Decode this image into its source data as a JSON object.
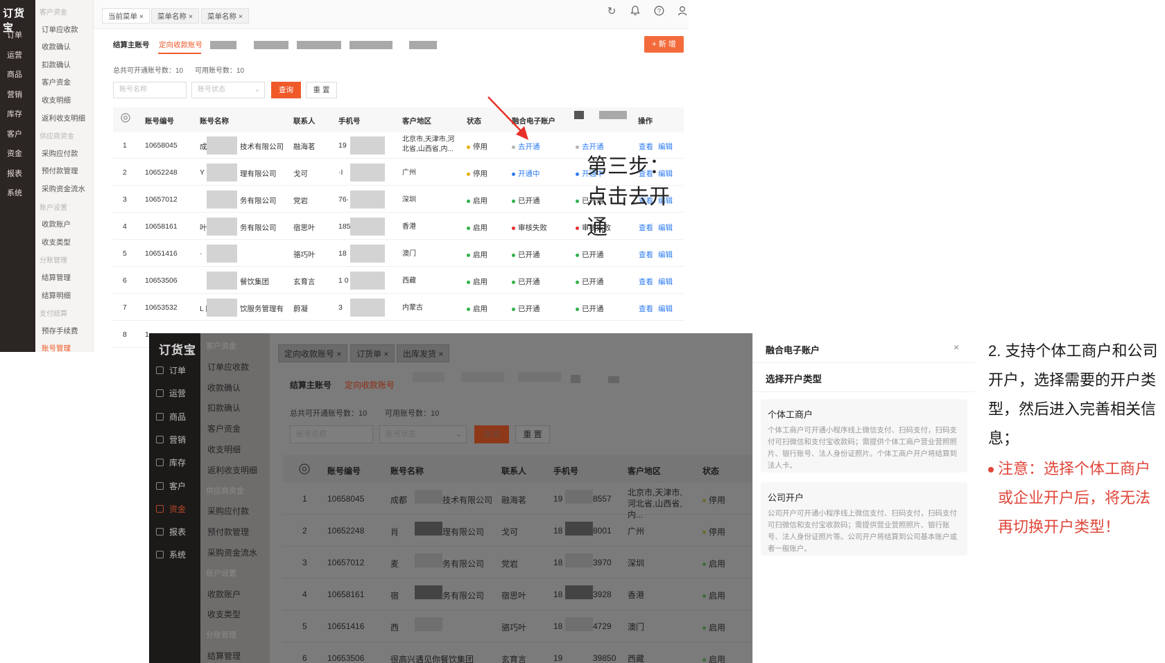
{
  "colors": {
    "accent": "#f05a28",
    "link": "#2d7cf0",
    "warn": "#e0463a",
    "ok": "#30b14a",
    "pause": "#e5b000",
    "fail": "#e03030"
  },
  "top": {
    "logo": "订货宝",
    "nav": [
      "订单",
      "运营",
      "商品",
      "营销",
      "库存",
      "客户",
      "资金",
      "报表",
      "系统"
    ],
    "sub_nav": [
      {
        "type": "group",
        "label": "客户资金"
      },
      {
        "type": "item",
        "label": "订单应收款"
      },
      {
        "type": "item",
        "label": "收款确认"
      },
      {
        "type": "item",
        "label": "扣款确认"
      },
      {
        "type": "item",
        "label": "客户资金"
      },
      {
        "type": "item",
        "label": "收支明细"
      },
      {
        "type": "item",
        "label": "返利收支明细"
      },
      {
        "type": "group",
        "label": "供应商资金"
      },
      {
        "type": "item",
        "label": "采购应付款"
      },
      {
        "type": "item",
        "label": "预付款管理"
      },
      {
        "type": "item",
        "label": "采购资金流水"
      },
      {
        "type": "group",
        "label": "账户设置"
      },
      {
        "type": "item",
        "label": "收款账户"
      },
      {
        "type": "item",
        "label": "收支类型"
      },
      {
        "type": "group",
        "label": "分账管理"
      },
      {
        "type": "item",
        "label": "结算管理"
      },
      {
        "type": "item",
        "label": "结算明细"
      },
      {
        "type": "group",
        "label": "支付结算"
      },
      {
        "type": "item",
        "label": "预存手续费"
      },
      {
        "type": "item",
        "label": "账号管理"
      }
    ],
    "tabs": [
      "当前菜单 ×",
      "菜单名称 ×",
      "菜单名称 ×"
    ],
    "subtabs": [
      "结算主账号",
      "定向收款账号"
    ],
    "add_button": "+ 新 增",
    "count_total": "总共可开通账号数：10",
    "count_avail": "可用账号数：10",
    "search_name_placeholder": "账号名称",
    "search_status_placeholder": "账号状态",
    "query_button": "查询",
    "reset_button": "重 置",
    "columns": [
      "账号编号",
      "账号名称",
      "联系人",
      "手机号",
      "客户地区",
      "状态",
      "融合电子账户",
      "操作"
    ],
    "rows": [
      {
        "idx": "1",
        "id": "10658045",
        "name_a": "成",
        "name_b": "技术有限公司",
        "contact": "融海茗",
        "phone": "19",
        "region": "北京市,天津市,河北省,山西省,内...",
        "status": "停用",
        "status_kind": "pause",
        "fusion": "去开通",
        "fusion_kind": "link",
        "extra": "去开通",
        "extra_kind": "link"
      },
      {
        "idx": "2",
        "id": "10652248",
        "name_a": "Y",
        "name_b": "理有限公司",
        "contact": "戈可",
        "phone": "·I",
        "region": "广州",
        "status": "停用",
        "status_kind": "pause",
        "fusion": "开通中",
        "fusion_kind": "blue",
        "extra": "开通中",
        "extra_kind": "blue"
      },
      {
        "idx": "3",
        "id": "10657012",
        "name_a": "",
        "name_b": "务有限公司",
        "contact": "党岩",
        "phone": "76·",
        "region": "深圳",
        "status": "启用",
        "status_kind": "ok",
        "fusion": "已开通",
        "fusion_kind": "ok",
        "extra": "已开通",
        "extra_kind": "ok"
      },
      {
        "idx": "4",
        "id": "10658161",
        "name_a": "叶",
        "name_b": "务有限公司",
        "contact": "宿思叶",
        "phone": "185",
        "region": "香港",
        "status": "启用",
        "status_kind": "ok",
        "fusion": "审核失败",
        "fusion_kind": "fail",
        "extra": "审核失败",
        "extra_kind": "fail"
      },
      {
        "idx": "5",
        "id": "10651416",
        "name_a": "·",
        "name_b": "",
        "contact": "骆巧叶",
        "phone": "18",
        "region": "澳门",
        "status": "启用",
        "status_kind": "ok",
        "fusion": "已开通",
        "fusion_kind": "ok",
        "extra": "已开通",
        "extra_kind": "ok"
      },
      {
        "idx": "6",
        "id": "10653506",
        "name_a": "",
        "name_b": "餐饮集团",
        "contact": "玄育言",
        "phone": "1 0",
        "region": "西藏",
        "status": "启用",
        "status_kind": "ok",
        "fusion": "已开通",
        "fusion_kind": "ok",
        "extra": "已开通",
        "extra_kind": "ok"
      },
      {
        "idx": "7",
        "id": "10653532",
        "name_a": "L 限",
        "name_b": "饮服务管理有",
        "contact": "蔚凝",
        "phone": "3",
        "region": "内蒙古",
        "status": "启用",
        "status_kind": "ok",
        "fusion": "已开通",
        "fusion_kind": "ok",
        "extra": "已开通",
        "extra_kind": "ok"
      },
      {
        "idx": "8",
        "id": "1",
        "name_a": "",
        "name_b": "",
        "contact": "",
        "phone": "",
        "region": "",
        "status": "",
        "status_kind": "",
        "fusion": "",
        "fusion_kind": "",
        "extra": "",
        "extra_kind": ""
      }
    ],
    "op_view": "查看",
    "op_edit": "编辑",
    "step_note": "第三步：点击去开通"
  },
  "bottom": {
    "logo": "订货宝",
    "nav": [
      "订单",
      "运营",
      "商品",
      "营销",
      "库存",
      "客户",
      "资金",
      "报表",
      "系统"
    ],
    "sub_nav": [
      {
        "type": "group",
        "label": "客户资金"
      },
      {
        "type": "item",
        "label": "订单应收款"
      },
      {
        "type": "item",
        "label": "收款确认"
      },
      {
        "type": "item",
        "label": "扣款确认"
      },
      {
        "type": "item",
        "label": "客户资金"
      },
      {
        "type": "item",
        "label": "收支明细"
      },
      {
        "type": "item",
        "label": "返利收支明细"
      },
      {
        "type": "group",
        "label": "供应商资金"
      },
      {
        "type": "item",
        "label": "采购应付款"
      },
      {
        "type": "item",
        "label": "预付款管理"
      },
      {
        "type": "item",
        "label": "采购资金流水"
      },
      {
        "type": "group",
        "label": "账户设置"
      },
      {
        "type": "item",
        "label": "收款账户"
      },
      {
        "type": "item",
        "label": "收支类型"
      },
      {
        "type": "group",
        "label": "分账管理"
      },
      {
        "type": "item",
        "label": "结算管理"
      }
    ],
    "tabs": [
      "定向收款账号 ×",
      "订货单 ×",
      "出库发货 ×"
    ],
    "subtabs": [
      "结算主账号",
      "定向收款账号"
    ],
    "count_total": "总共可开通账号数：10",
    "count_avail": "可用账号数：10",
    "search_name_placeholder": "账号名称",
    "search_status_placeholder": "账号状态",
    "query_button": "查询",
    "reset_button": "重 置",
    "columns": [
      "账号编号",
      "账号名称",
      "联系人",
      "手机号",
      "客户地区",
      "状态"
    ],
    "rows": [
      {
        "idx": "1",
        "id": "10658045",
        "name_a": "成都",
        "name_b": "技术有限公司",
        "contact": "融海茗",
        "phone_a": "19",
        "phone_b": "8557",
        "region": "北京市,天津市,河北省,山西省,内...",
        "status": "停用",
        "kind": "y"
      },
      {
        "idx": "2",
        "id": "10652248",
        "name_a": "肖",
        "name_b": "理有限公司",
        "contact": "戈可",
        "phone_a": "18",
        "phone_b": "8001",
        "region": "广州",
        "status": "停用",
        "kind": "y"
      },
      {
        "idx": "3",
        "id": "10657012",
        "name_a": "麦",
        "name_b": "务有限公司",
        "contact": "党岩",
        "phone_a": "18",
        "phone_b": "3970",
        "region": "深圳",
        "status": "启用",
        "kind": "g"
      },
      {
        "idx": "4",
        "id": "10658161",
        "name_a": "宿",
        "name_b": "务有限公司",
        "contact": "宿思叶",
        "phone_a": "18",
        "phone_b": "3928",
        "region": "香港",
        "status": "启用",
        "kind": "g"
      },
      {
        "idx": "5",
        "id": "10651416",
        "name_a": "西",
        "name_b": "",
        "contact": "骆巧叶",
        "phone_a": "18",
        "phone_b": "4729",
        "region": "澳门",
        "status": "启用",
        "kind": "g"
      },
      {
        "idx": "6",
        "id": "10653506",
        "name_a": "很高兴遇见你餐饮集团",
        "name_b": "",
        "contact": "玄育言",
        "phone_a": "19",
        "phone_b": "39850",
        "region": "西藏",
        "status": "启用",
        "kind": "g"
      }
    ]
  },
  "drawer": {
    "title": "融合电子账户",
    "close": "×",
    "section": "选择开户类型",
    "cards": [
      {
        "title": "个体工商户",
        "desc": "个体工商户可开通小程序线上微信支付、扫码支付，扫码支付可扫微信和支付宝收款码；需提供个体工商户营业营照照片、银行账号、法人身份证照片。个体工商户开户将结算到法人卡。"
      },
      {
        "title": "公司开户",
        "desc": "公司开户可开通小程序线上微信支付、扫码支付，扫码支付可扫微信和支付宝收款码；需提供营业营照照片、银行账号、法人身份证照片等。公司开户将结算到公司基本账户或者一般账户。"
      }
    ]
  },
  "notes": {
    "main": "2. 支持个体工商户和公司开户，选择需要的开户类型，然后进入完善相关信息；",
    "warn": "注意：选择个体工商户或企业开户后，将无法再切换开户类型！"
  }
}
